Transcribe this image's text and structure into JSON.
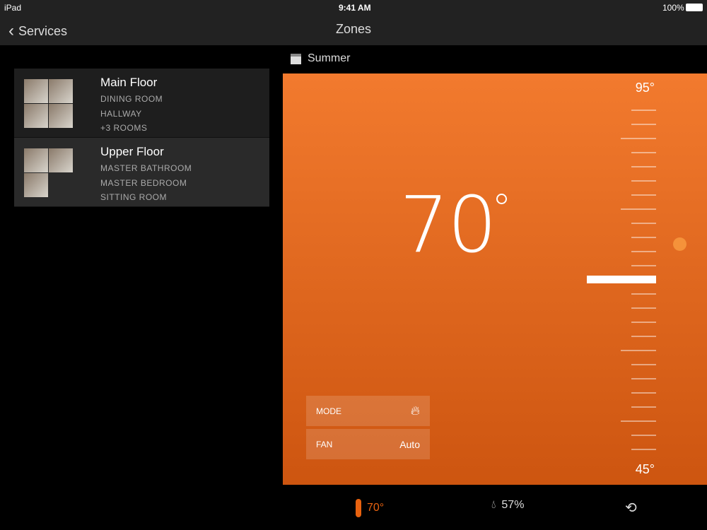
{
  "status": {
    "device": "iPad",
    "time": "9:41 AM",
    "battery": "100%"
  },
  "nav": {
    "back": "Services",
    "title": "Zones"
  },
  "zones": [
    {
      "name": "Main Floor",
      "rooms": [
        "DINING ROOM",
        "HALLWAY",
        "+3 ROOMS"
      ]
    },
    {
      "name": "Upper Floor",
      "rooms": [
        "MASTER BATHROOM",
        "MASTER BEDROOM",
        "SITTING ROOM"
      ]
    }
  ],
  "schedule": "Summer",
  "thermostat": {
    "current": "70",
    "max": "95°",
    "min": "45°",
    "setpoint": 70,
    "mode_label": "MODE",
    "mode_icon": "flame-icon",
    "fan_label": "FAN",
    "fan_value": "Auto",
    "accent": "#f27a2e"
  },
  "bottom": {
    "temp": "70°",
    "humidity": "57%"
  }
}
